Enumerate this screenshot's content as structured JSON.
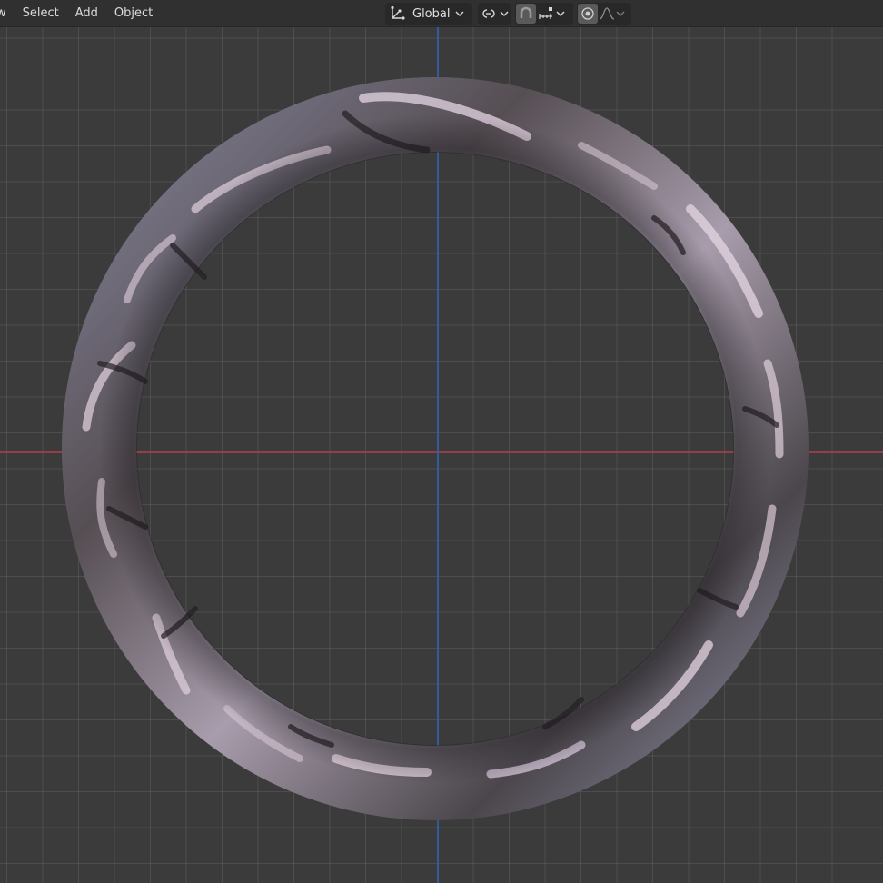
{
  "header": {
    "menu": [
      {
        "label": "ew"
      },
      {
        "label": "Select"
      },
      {
        "label": "Add"
      },
      {
        "label": "Object"
      }
    ],
    "transform_orientation": "Global"
  },
  "icons": {
    "orientation": "transform-orientation-icon",
    "pivot": "pivot-point-icon",
    "snap": "snap-magnet-icon",
    "snap_target": "snap-increment-icon",
    "proportional": "proportional-editing-icon",
    "falloff": "falloff-curve-icon"
  },
  "colors": {
    "x_axis": "#a4414b",
    "y_axis": "#2f5fa6",
    "background": "#3b3b3b"
  }
}
